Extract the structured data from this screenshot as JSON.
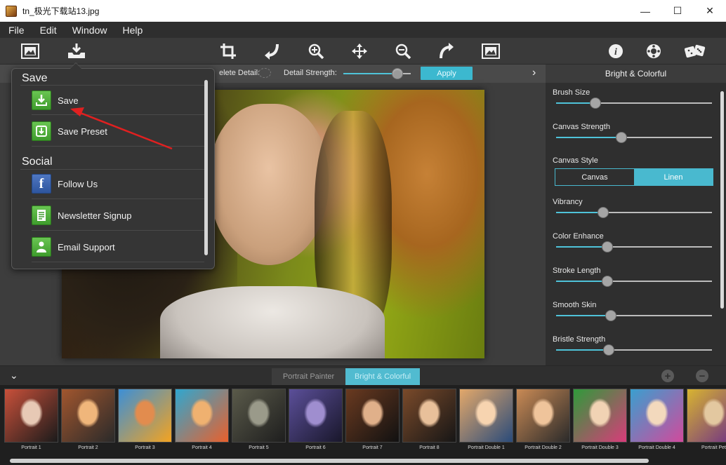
{
  "window": {
    "title": "tn_极光下载站13.jpg",
    "minimize": "—",
    "maximize": "☐",
    "close": "✕"
  },
  "menu": {
    "file": "File",
    "edit": "Edit",
    "window": "Window",
    "help": "Help"
  },
  "toolbar": {
    "open_icon": "image-frame-icon",
    "save_icon": "save-tray-icon",
    "crop_icon": "crop-icon",
    "rotate_left_icon": "rotate-left-icon",
    "zoom_in_icon": "zoom-in-icon",
    "move_icon": "move-icon",
    "zoom_out_icon": "zoom-out-icon",
    "rotate_right_icon": "rotate-right-icon",
    "fit_icon": "fit-image-icon",
    "info_icon": "info-icon",
    "settings_icon": "settings-icon",
    "random_icon": "dice-icon"
  },
  "options_bar": {
    "delete_detail_label": "elete Detail:",
    "detail_strength_label": "Detail Strength:",
    "detail_strength_value": 0.8,
    "apply_label": "Apply"
  },
  "save_popup": {
    "save_section": "Save",
    "items_save": [
      {
        "label": "Save",
        "icon": "download-icon"
      },
      {
        "label": "Save Preset",
        "icon": "preset-download-icon"
      }
    ],
    "social_section": "Social",
    "items_social": [
      {
        "label": "Follow Us",
        "icon": "facebook-icon"
      },
      {
        "label": "Newsletter Signup",
        "icon": "newsletter-icon"
      },
      {
        "label": "Email Support",
        "icon": "person-icon"
      }
    ]
  },
  "right_panel": {
    "title": "Bright & Colorful",
    "sliders": [
      {
        "label": "Brush Size",
        "value": 0.25
      },
      {
        "label": "Canvas Strength",
        "value": 0.42
      },
      {
        "label": "Vibrancy",
        "value": 0.3
      },
      {
        "label": "Color Enhance",
        "value": 0.33
      },
      {
        "label": "Stroke Length",
        "value": 0.33
      },
      {
        "label": "Smooth Skin",
        "value": 0.35
      },
      {
        "label": "Bristle Strength",
        "value": 0.34
      }
    ],
    "canvas_style_label": "Canvas Style",
    "canvas_style_options": [
      "Canvas",
      "Linen"
    ],
    "canvas_style_selected": "Linen"
  },
  "style_tabs": {
    "tab1": "Portrait Painter",
    "tab2": "Bright & Colorful",
    "add": "+",
    "remove": "−"
  },
  "thumbnails": [
    {
      "label": "Portrait 1",
      "colors": [
        "#c8503a",
        "#1b1b1b",
        "#e7c9b5"
      ]
    },
    {
      "label": "Portrait 2",
      "colors": [
        "#a1562e",
        "#2a2a2a",
        "#f0b67b"
      ]
    },
    {
      "label": "Portrait 3",
      "colors": [
        "#3c8fd6",
        "#f3a321",
        "#e28c4e"
      ]
    },
    {
      "label": "Portrait 4",
      "colors": [
        "#2fa7d0",
        "#e9602c",
        "#efb170"
      ]
    },
    {
      "label": "Portrait 5",
      "colors": [
        "#5a5a4a",
        "#1e1e1e",
        "#9a9a8a"
      ]
    },
    {
      "label": "Portrait 6",
      "colors": [
        "#5b4f99",
        "#19172b",
        "#9f8ecf"
      ]
    },
    {
      "label": "Portrait 7",
      "colors": [
        "#6a3a20",
        "#111111",
        "#e0b08a"
      ]
    },
    {
      "label": "Portrait 8",
      "colors": [
        "#7a4a2a",
        "#161616",
        "#e8c09a"
      ]
    },
    {
      "label": "Portrait Double 1",
      "colors": [
        "#e3a86a",
        "#2a4b7a",
        "#f7d4b0"
      ]
    },
    {
      "label": "Portrait Double 2",
      "colors": [
        "#c98a55",
        "#2a2a2a",
        "#efc49b"
      ]
    },
    {
      "label": "Portrait Double 3",
      "colors": [
        "#2f9a3a",
        "#d83c7a",
        "#f1d3b4"
      ]
    },
    {
      "label": "Portrait Double 4",
      "colors": [
        "#3a9fcf",
        "#d14a9c",
        "#f3d9bd"
      ]
    },
    {
      "label": "Portrait Pet",
      "colors": [
        "#d8b430",
        "#6a2a8a",
        "#e3c8a0"
      ]
    }
  ]
}
